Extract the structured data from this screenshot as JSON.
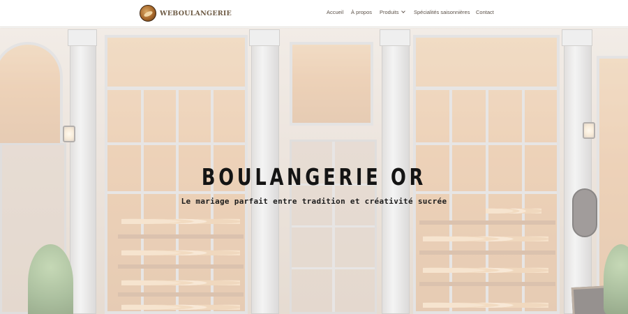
{
  "brand": {
    "name": "WEBOULANGERIE"
  },
  "nav": {
    "items": [
      {
        "label": "Accueil"
      },
      {
        "label": "À propos"
      },
      {
        "label": "Produits",
        "has_dropdown": true
      },
      {
        "label": "Spécialités saisonnières"
      },
      {
        "label": "Contact"
      }
    ]
  },
  "hero": {
    "title": "BOULANGERIE OR",
    "subtitle": "Le mariage parfait entre tradition et créativité sucrée"
  },
  "colors": {
    "nav_text": "#5c5148",
    "brand_text": "#6d5a44",
    "hero_text": "#141414"
  }
}
